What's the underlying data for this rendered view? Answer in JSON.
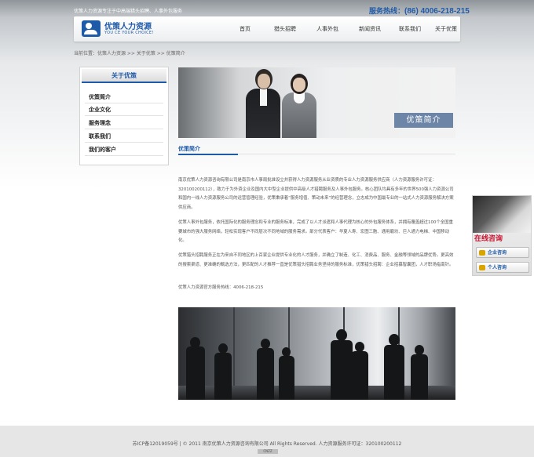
{
  "header": {
    "tagline": "优策人力资源专注于中高端猎头招聘、人事外包服务",
    "hotline_label": "服务热线：",
    "hotline_number": "(86) 4006-218-215",
    "logo_cn": "优策人力资源",
    "logo_en": "YOU CE YOUR CHOICE!"
  },
  "nav": [
    {
      "label": "首页"
    },
    {
      "label": "猎头招聘"
    },
    {
      "label": "人事外包"
    },
    {
      "label": "新闻资讯"
    },
    {
      "label": "联系我们"
    },
    {
      "label": "关于优策"
    }
  ],
  "breadcrumb": "当前位置：优策人力资源 >> 关于优策 >> 优策简介",
  "sidebar": {
    "title": "关于优策",
    "items": [
      {
        "label": "优策简介"
      },
      {
        "label": "企业文化"
      },
      {
        "label": "服务理念"
      },
      {
        "label": "联系我们"
      },
      {
        "label": "我们的客户"
      }
    ]
  },
  "banner": {
    "caption": "优策简介"
  },
  "content": {
    "section_title": "优策简介",
    "paragraphs": [
      "南京优策人力资源咨询有限公司是南京市人事局批准设立并获得人力资源服务从业资质的专业人力资源服务供应商（人力资源服务许可证：320100200112），致力于为外资企业及国内大中型企业提供中高级人才猎聘服务及人事外包服务。核心团队均具有多年的世界500强人力资源公司和国内一线人力资源服务公司的运营管理经验，优策秉承着“服务增值、策动未来”的经营理念，立志成为中国最专业的一站式人力资源服务解决方案供应商。",
      "优策人事外包服务，依托国际化的服务理念和专业的服务标准，完成了以人才派遣和人事代理为核心的外包服务体系，并拥有覆盖超过100个全国重要城市的强大服务网络，轻松实现客户不同层次不同地域的服务需求。部分代表客户：华夏人寿、宏图三胞、通用磨坊、巨人通力电梯、中国移动化。",
      "优策猎头招聘服务正在为来自不同地区的上百家企业提供专业化的人才服务，并确立了制造、化工、消费品、服务、金融等领域的品牌优势。更高效的搜索渠道、更准确的甄选方法，更匹配的人才推荐一直是优策猎头招聘业务坚持的服务标准，优策猎头招聘：企业招募智囊团，人才职场指南针。",
      "优策人力资源官方服务热线：4006-218-215"
    ]
  },
  "consult": {
    "title": "在线咨询",
    "buttons": [
      {
        "label": "企业咨询"
      },
      {
        "label": "个人咨询"
      }
    ]
  },
  "footer": {
    "text": "苏ICP备12019059号 | © 2011 南京优策人力资源咨询有限公司 All Rights Reserved.  人力资源服务许可证：320100200112",
    "badge": "CNZZ"
  }
}
